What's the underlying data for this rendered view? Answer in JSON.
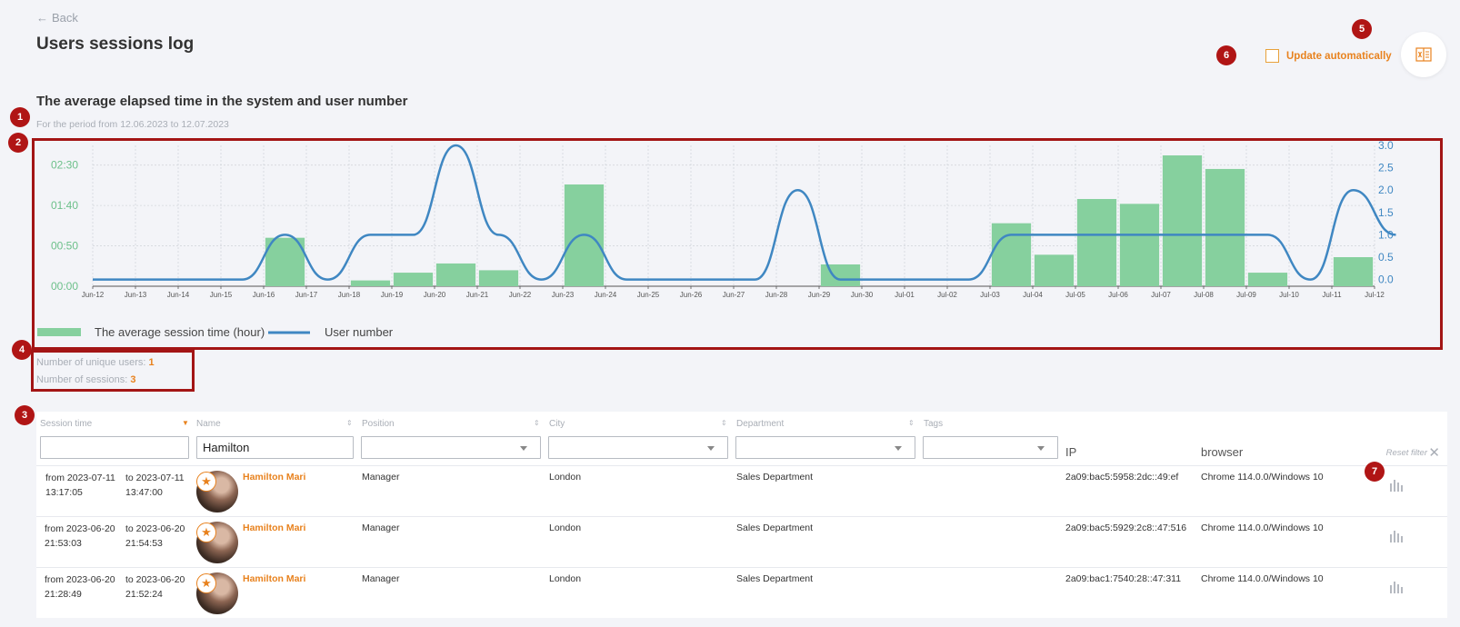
{
  "header": {
    "back_label": "Back",
    "title": "Users sessions log",
    "update_auto_label": "Update automatically"
  },
  "section": {
    "title": "The average elapsed time in the system and user number",
    "period": "For the period from 12.06.2023 to 12.07.2023"
  },
  "markers": [
    "1",
    "2",
    "3",
    "4",
    "5",
    "6",
    "7"
  ],
  "chart_data": {
    "type": "bar",
    "categories": [
      "Jun-12",
      "Jun-13",
      "Jun-14",
      "Jun-15",
      "Jun-16",
      "Jun-17",
      "Jun-18",
      "Jun-19",
      "Jun-20",
      "Jun-21",
      "Jun-22",
      "Jun-23",
      "Jun-24",
      "Jun-25",
      "Jun-26",
      "Jun-27",
      "Jun-28",
      "Jun-29",
      "Jun-30",
      "Jul-01",
      "Jul-02",
      "Jul-03",
      "Jul-04",
      "Jul-05",
      "Jul-06",
      "Jul-07",
      "Jul-08",
      "Jul-09",
      "Jul-10",
      "Jul-11",
      "Jul-12"
    ],
    "series": [
      {
        "name": "The average session time (hour)",
        "type": "bar",
        "axis": "left",
        "color": "#86d09e",
        "values": [
          0,
          0,
          0,
          0,
          1.0,
          0,
          0.12,
          0.28,
          0.47,
          0.33,
          0,
          2.1,
          0,
          0,
          0,
          0,
          0,
          0.45,
          0,
          0,
          0,
          1.3,
          0.65,
          1.8,
          1.7,
          2.7,
          2.42,
          0.28,
          0,
          0.6,
          0
        ]
      },
      {
        "name": "User number",
        "type": "line",
        "axis": "right",
        "color": "#3f87c2",
        "values": [
          0,
          0,
          0,
          0,
          1,
          0,
          1,
          1,
          3,
          1,
          0,
          1,
          0,
          0,
          0,
          0,
          2,
          0,
          0,
          0,
          0,
          1,
          1,
          1,
          1,
          1,
          1,
          1,
          0,
          2,
          1
        ]
      }
    ],
    "left_axis": {
      "ticks": [
        "00:00",
        "00:50",
        "01:40",
        "02:30"
      ],
      "tick_values": [
        0,
        0.8333,
        1.6667,
        2.5
      ],
      "min": 0,
      "max": 2.85
    },
    "right_axis": {
      "ticks": [
        "0.0",
        "0.5",
        "1.0",
        "1.5",
        "2.0",
        "2.5",
        "3.0"
      ],
      "min": -0.15,
      "max": 3.0
    },
    "legend": "bottom-left",
    "grid": true
  },
  "stats": {
    "unique_users_label": "Number of unique users:",
    "unique_users_value": "1",
    "sessions_label": "Number of sessions:",
    "sessions_value": "3"
  },
  "table": {
    "columns": {
      "session_time": "Session time",
      "name": "Name",
      "position": "Position",
      "city": "City",
      "department": "Department",
      "tags": "Tags",
      "ip": "IP",
      "browser": "browser"
    },
    "filter_name_value": "Hamilton",
    "reset_filter_label": "Reset filter",
    "rows": [
      {
        "from_date": "from 2023-07-11",
        "from_time": "13:17:05",
        "to_date": "to 2023-07-11",
        "to_time": "13:47:00",
        "name": "Hamilton Mari",
        "position": "Manager",
        "city": "London",
        "department": "Sales Department",
        "ip": "2a09:bac5:5958:2dc::49:ef",
        "browser": "Chrome 114.0.0/Windows 10"
      },
      {
        "from_date": "from 2023-06-20",
        "from_time": "21:53:03",
        "to_date": "to 2023-06-20",
        "to_time": "21:54:53",
        "name": "Hamilton Mari",
        "position": "Manager",
        "city": "London",
        "department": "Sales Department",
        "ip": "2a09:bac5:5929:2c8::47:516",
        "browser": "Chrome 114.0.0/Windows 10"
      },
      {
        "from_date": "from 2023-06-20",
        "from_time": "21:28:49",
        "to_date": "to 2023-06-20",
        "to_time": "21:52:24",
        "name": "Hamilton Mari",
        "position": "Manager",
        "city": "London",
        "department": "Sales Department",
        "ip": "2a09:bac1:7540:28::47:311",
        "browser": "Chrome 114.0.0/Windows 10"
      }
    ]
  }
}
